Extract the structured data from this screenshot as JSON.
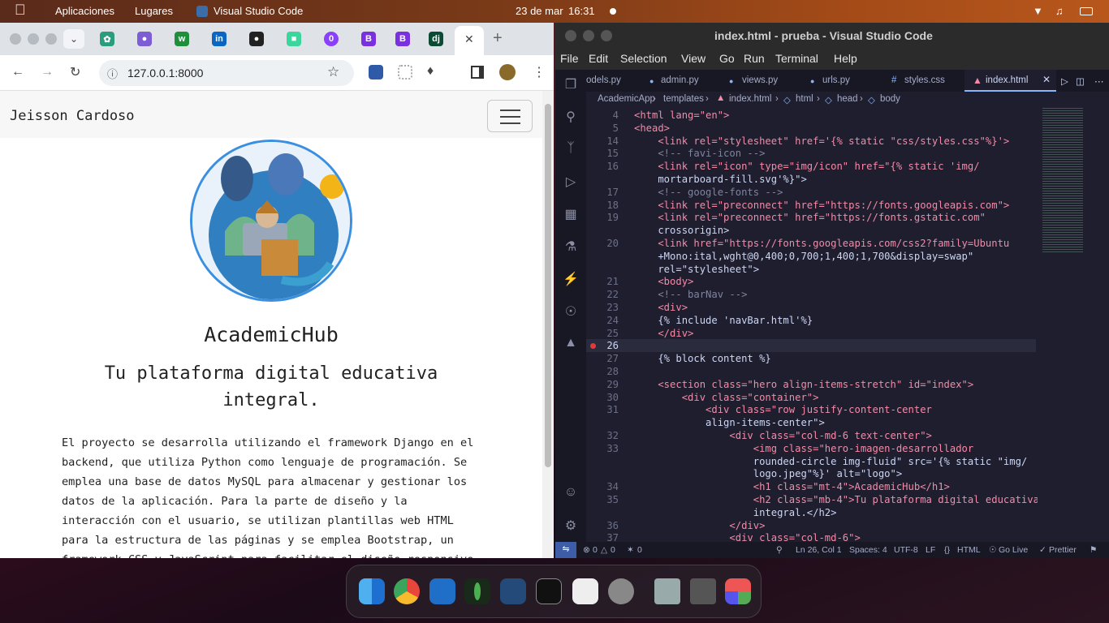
{
  "topbar": {
    "apps": "Aplicaciones",
    "places": "Lugares",
    "active_app": "Visual Studio Code",
    "date": "23 de mar",
    "time": "16:31"
  },
  "browser": {
    "url": "127.0.0.1:8000",
    "brand": "Jeisson Cardoso",
    "hero_title": "AcademicHub",
    "hero_subtitle": "Tu plataforma digital educativa integral.",
    "paragraph": "El proyecto se desarrolla utilizando el framework Django en el backend, que utiliza Python como lenguaje de programación. Se emplea una base de datos MySQL para almacenar y gestionar los datos de la aplicación. Para la parte de diseño y la interacción con el usuario, se utilizan plantillas web HTML para la estructura de las páginas y se emplea Bootstrap, un framework CSS y JavaScript  para facilitar el diseño responsivo y la"
  },
  "vscode": {
    "title": "index.html - prueba - Visual Studio Code",
    "menu": [
      "File",
      "Edit",
      "Selection",
      "View",
      "Go",
      "Run",
      "Terminal",
      "Help"
    ],
    "tabs": [
      "odels.py",
      "admin.py",
      "views.py",
      "urls.py",
      "styles.css",
      "index.html"
    ],
    "breadcrumb": [
      "AcademicApp",
      "templates",
      "index.html",
      "html",
      "head",
      "body"
    ],
    "lines": [
      {
        "n": "4",
        "code": "<html lang=\"en\">"
      },
      {
        "n": "5",
        "code": "<head>"
      },
      {
        "n": "14",
        "code": "    <link rel=\"stylesheet\" href='{% static \"css/styles.css\"%}'>"
      },
      {
        "n": "15",
        "code": "    <!-- favi-icon -->"
      },
      {
        "n": "16",
        "code": "    <link rel=\"icon\" type=\"img/icon\" href=\"{% static 'img/"
      },
      {
        "n": "",
        "code": "    mortarboard-fill.svg'%}\">"
      },
      {
        "n": "17",
        "code": "    <!-- google-fonts -->"
      },
      {
        "n": "18",
        "code": "    <link rel=\"preconnect\" href=\"https://fonts.googleapis.com\">"
      },
      {
        "n": "19",
        "code": "    <link rel=\"preconnect\" href=\"https://fonts.gstatic.com\""
      },
      {
        "n": "",
        "code": "    crossorigin>"
      },
      {
        "n": "20",
        "code": "    <link href=\"https://fonts.googleapis.com/css2?family=Ubuntu"
      },
      {
        "n": "",
        "code": "    +Mono:ital,wght@0,400;0,700;1,400;1,700&display=swap\""
      },
      {
        "n": "",
        "code": "    rel=\"stylesheet\">"
      },
      {
        "n": "21",
        "code": "    <body>"
      },
      {
        "n": "22",
        "code": "    <!-- barNav -->"
      },
      {
        "n": "23",
        "code": "    <div>"
      },
      {
        "n": "24",
        "code": "    {% include 'navBar.html'%}"
      },
      {
        "n": "25",
        "code": "    </div>"
      },
      {
        "n": "26",
        "code": ""
      },
      {
        "n": "27",
        "code": "    {% block content %}"
      },
      {
        "n": "28",
        "code": ""
      },
      {
        "n": "29",
        "code": "    <section class=\"hero align-items-stretch\" id=\"index\">"
      },
      {
        "n": "30",
        "code": "        <div class=\"container\">"
      },
      {
        "n": "31",
        "code": "            <div class=\"row justify-content-center"
      },
      {
        "n": "",
        "code": "            align-items-center\">"
      },
      {
        "n": "32",
        "code": "                <div class=\"col-md-6 text-center\">"
      },
      {
        "n": "33",
        "code": "                    <img class=\"hero-imagen-desarrollador"
      },
      {
        "n": "",
        "code": "                    rounded-circle img-fluid\" src='{% static \"img/"
      },
      {
        "n": "",
        "code": "                    logo.jpeg\"%}' alt=\"logo\">"
      },
      {
        "n": "34",
        "code": "                    <h1 class=\"mt-4\">AcademicHub</h1>"
      },
      {
        "n": "35",
        "code": "                    <h2 class=\"mb-4\">Tu plataforma digital educativa"
      },
      {
        "n": "",
        "code": "                    integral.</h2>"
      },
      {
        "n": "36",
        "code": "                </div>"
      },
      {
        "n": "37",
        "code": "                <div class=\"col-md-6\">"
      }
    ],
    "status": {
      "errors": "0",
      "warnings": "0",
      "ports": "0",
      "position": "Ln 26, Col 1",
      "spaces": "Spaces: 4",
      "encoding": "UTF-8",
      "eol": "LF",
      "language": "HTML",
      "golive": "Go Live",
      "prettier": "Prettier"
    }
  },
  "colors": {
    "vscode_bg": "#1e1e2e",
    "tag": "#f38ba8",
    "attr": "#f9e2af",
    "string": "#a6e3a1",
    "comment": "#7f849c"
  }
}
